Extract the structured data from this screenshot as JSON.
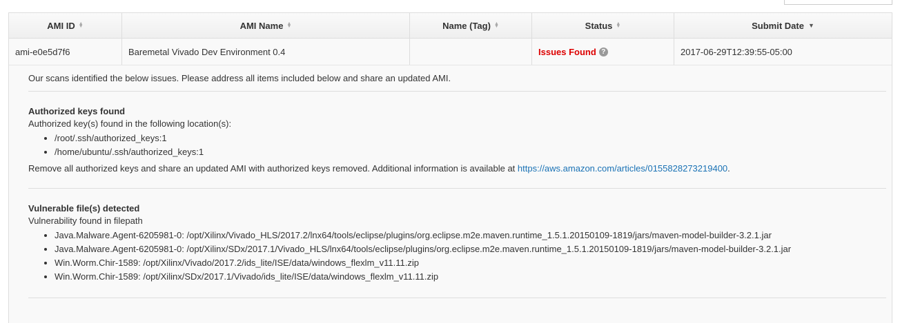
{
  "table": {
    "headers": [
      "AMI ID",
      "AMI Name",
      "Name (Tag)",
      "Status",
      "Submit Date"
    ],
    "row": {
      "ami_id": "ami-e0e5d7f6",
      "ami_name": "Baremetal Vivado Dev Environment 0.4",
      "name_tag": "",
      "status": "Issues Found",
      "submit_date": "2017-06-29T12:39:55-05:00"
    }
  },
  "details": {
    "intro": "Our scans identified the below issues. Please address all items included below and share an updated AMI.",
    "sections": [
      {
        "title": "Authorized keys found",
        "subtitle": "Authorized key(s) found in the following location(s):",
        "items": [
          "/root/.ssh/authorized_keys:1",
          "/home/ubuntu/.ssh/authorized_keys:1"
        ],
        "remediation": "Remove all authorized keys and share an updated AMI with authorized keys removed. Additional information is available at ",
        "link": "https://aws.amazon.com/articles/0155828273219400",
        "remediation_end": "."
      },
      {
        "title": "Vulnerable file(s) detected",
        "subtitle": "Vulnerability found in filepath",
        "items": [
          "Java.Malware.Agent-6205981-0: /opt/Xilinx/Vivado_HLS/2017.2/lnx64/tools/eclipse/plugins/org.eclipse.m2e.maven.runtime_1.5.1.20150109-1819/jars/maven-model-builder-3.2.1.jar",
          "Java.Malware.Agent-6205981-0: /opt/Xilinx/SDx/2017.1/Vivado_HLS/lnx64/tools/eclipse/plugins/org.eclipse.m2e.maven.runtime_1.5.1.20150109-1819/jars/maven-model-builder-3.2.1.jar",
          "Win.Worm.Chir-1589: /opt/Xilinx/Vivado/2017.2/ids_lite/ISE/data/windows_flexlm_v11.11.zip",
          "Win.Worm.Chir-1589: /opt/Xilinx/SDx/2017.1/Vivado/ids_lite/ISE/data/windows_flexlm_v11.11.zip"
        ]
      }
    ]
  },
  "colors": {
    "status": "#dd0000",
    "link": "#1a72b5"
  }
}
